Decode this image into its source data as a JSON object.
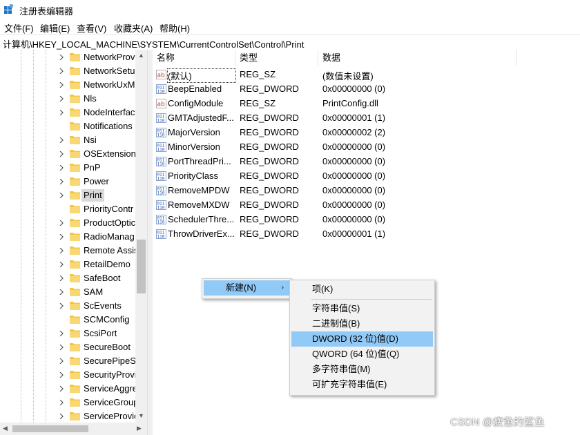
{
  "window": {
    "title": "注册表编辑器",
    "icon": "regedit-icon"
  },
  "menu": [
    "文件(F)",
    "编辑(E)",
    "查看(V)",
    "收藏夹(A)",
    "帮助(H)"
  ],
  "address": "计算机\\HKEY_LOCAL_MACHINE\\SYSTEM\\CurrentControlSet\\Control\\Print",
  "tree": {
    "items": [
      "NetworkProv",
      "NetworkSetu",
      "NetworkUxM",
      "Nls",
      "NodeInterfac",
      "Notifications",
      "Nsi",
      "OSExtensionI",
      "PnP",
      "Power",
      "Print",
      "PriorityContr",
      "ProductOptic",
      "RadioManag",
      "Remote Assis",
      "RetailDemo",
      "SafeBoot",
      "SAM",
      "ScEvents",
      "SCMConfig",
      "ScsiPort",
      "SecureBoot",
      "SecurePipeSe",
      "SecurityProvi",
      "ServiceAggre",
      "ServiceGroup",
      "ServiceProvic"
    ],
    "expandable": [
      true,
      true,
      true,
      true,
      true,
      false,
      true,
      true,
      true,
      true,
      true,
      false,
      true,
      true,
      true,
      true,
      true,
      true,
      true,
      false,
      true,
      true,
      true,
      true,
      true,
      true,
      true
    ],
    "selected": "Print"
  },
  "list": {
    "columns": [
      "名称",
      "类型",
      "数据"
    ],
    "rows": [
      {
        "name": "(默认)",
        "type": "REG_SZ",
        "data": "(数值未设置)",
        "icon": "string-value-icon"
      },
      {
        "name": "BeepEnabled",
        "type": "REG_DWORD",
        "data": "0x00000000 (0)",
        "icon": "binary-value-icon"
      },
      {
        "name": "ConfigModule",
        "type": "REG_SZ",
        "data": "PrintConfig.dll",
        "icon": "string-value-icon"
      },
      {
        "name": "GMTAdjustedF...",
        "type": "REG_DWORD",
        "data": "0x00000001 (1)",
        "icon": "binary-value-icon"
      },
      {
        "name": "MajorVersion",
        "type": "REG_DWORD",
        "data": "0x00000002 (2)",
        "icon": "binary-value-icon"
      },
      {
        "name": "MinorVersion",
        "type": "REG_DWORD",
        "data": "0x00000000 (0)",
        "icon": "binary-value-icon"
      },
      {
        "name": "PortThreadPri...",
        "type": "REG_DWORD",
        "data": "0x00000000 (0)",
        "icon": "binary-value-icon"
      },
      {
        "name": "PriorityClass",
        "type": "REG_DWORD",
        "data": "0x00000000 (0)",
        "icon": "binary-value-icon"
      },
      {
        "name": "RemoveMPDW",
        "type": "REG_DWORD",
        "data": "0x00000000 (0)",
        "icon": "binary-value-icon"
      },
      {
        "name": "RemoveMXDW",
        "type": "REG_DWORD",
        "data": "0x00000000 (0)",
        "icon": "binary-value-icon"
      },
      {
        "name": "SchedulerThre...",
        "type": "REG_DWORD",
        "data": "0x00000000 (0)",
        "icon": "binary-value-icon"
      },
      {
        "name": "ThrowDriverEx...",
        "type": "REG_DWORD",
        "data": "0x00000001 (1)",
        "icon": "binary-value-icon"
      }
    ]
  },
  "context_menu": {
    "item": "新建(N)"
  },
  "submenu": {
    "items": [
      "项(K)",
      "字符串值(S)",
      "二进制值(B)",
      "DWORD (32 位)值(D)",
      "QWORD (64 位)值(Q)",
      "多字符串值(M)",
      "可扩充字符串值(E)"
    ],
    "highlighted": "DWORD (32 位)值(D)"
  },
  "watermark": "CSDN @疲惫的鲨鱼",
  "colors": {
    "folder": "#f5c542",
    "highlight": "#91c9f7",
    "selected_tree": "#d9d9d9"
  }
}
